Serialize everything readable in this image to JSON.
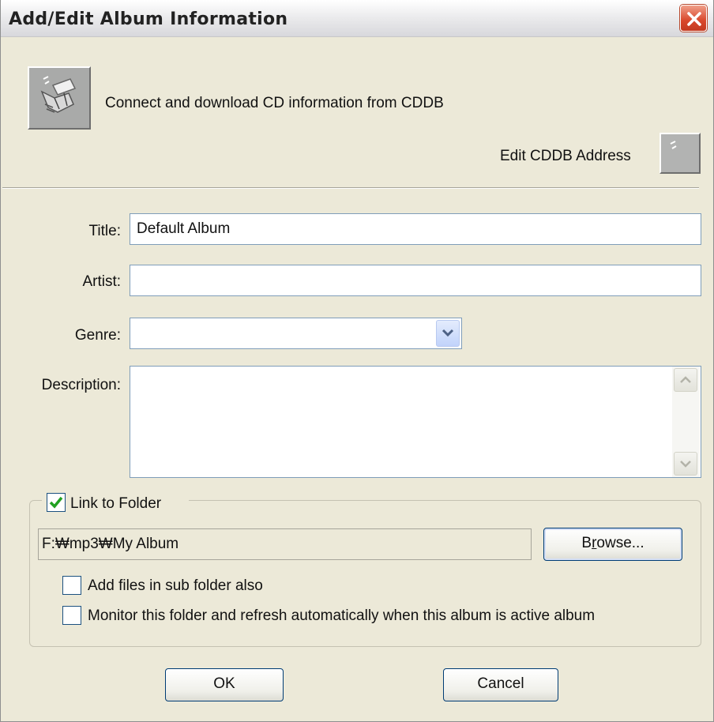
{
  "window": {
    "title": "Add/Edit Album Information"
  },
  "cddb": {
    "connect_label": "Connect and download CD information from CDDB",
    "edit_address_label": "Edit CDDB Address"
  },
  "form": {
    "title_label": "Title:",
    "title_value": "Default Album",
    "artist_label": "Artist:",
    "artist_value": "",
    "genre_label": "Genre:",
    "genre_value": "",
    "description_label": "Description:",
    "description_value": ""
  },
  "folder": {
    "link_label": "Link to Folder",
    "link_checked": true,
    "path": "F:₩mp3₩My Album",
    "browse_label_pre": "B",
    "browse_label_accel": "r",
    "browse_label_post": "owse...",
    "subfolder_label": "Add files in sub folder also",
    "subfolder_checked": false,
    "monitor_label": "Monitor this folder and refresh automatically when this album is active album",
    "monitor_checked": false
  },
  "buttons": {
    "ok": "OK",
    "cancel": "Cancel"
  },
  "icons": {
    "close": "close-icon",
    "cddb": "cd-notes-icon",
    "edit_address": "edit-icon",
    "combo": "chevron-down-icon",
    "scroll_up": "arrow-up-icon",
    "scroll_down": "arrow-down-icon",
    "check": "check-icon"
  },
  "colors": {
    "dialog_bg": "#ece9d8",
    "close_red": "#d9472b",
    "check_green": "#21a121",
    "field_border": "#7f9db9"
  }
}
